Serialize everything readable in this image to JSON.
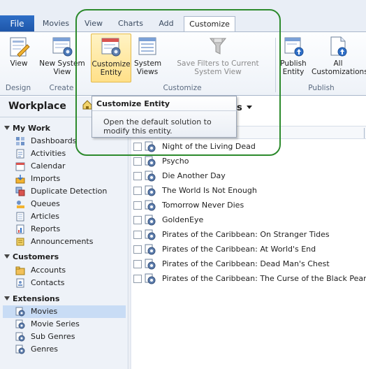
{
  "tabs": [
    {
      "label": "File",
      "active": false
    },
    {
      "label": "Movies",
      "active": false
    },
    {
      "label": "View",
      "active": false
    },
    {
      "label": "Charts",
      "active": false
    },
    {
      "label": "Add",
      "active": false
    },
    {
      "label": "Customize",
      "active": true
    }
  ],
  "ribbon": {
    "buttons": [
      {
        "label": "View",
        "icon": "pencil-form-icon"
      },
      {
        "label": "New System View",
        "icon": "new-view-icon"
      },
      {
        "label": "Customize Entity",
        "icon": "customize-entity-icon"
      },
      {
        "label": "System Views",
        "icon": "system-views-icon"
      },
      {
        "label": "Save Filters to Current System View",
        "icon": "filter-icon"
      },
      {
        "label": "Publish Entity",
        "icon": "publish-entity-icon"
      },
      {
        "label": "All Customizations",
        "icon": "publish-all-icon"
      }
    ],
    "groups": [
      "Design",
      "Create",
      "Customize",
      "Publish"
    ]
  },
  "tooltip": {
    "title": "Customize Entity",
    "body": "Open the default solution to modify this entity."
  },
  "nav": {
    "title": "Workplace",
    "sections": [
      {
        "label": "My Work",
        "items": [
          "Dashboards",
          "Activities",
          "Calendar",
          "Imports",
          "Duplicate Detection",
          "Queues",
          "Articles",
          "Reports",
          "Announcements"
        ]
      },
      {
        "label": "Customers",
        "items": [
          "Accounts",
          "Contacts"
        ]
      },
      {
        "label": "Extensions",
        "items": [
          "Movies",
          "Movie Series",
          "Sub Genres",
          "Genres"
        ]
      }
    ],
    "selected": "Movies"
  },
  "grid": {
    "view_suffix": "s",
    "rows": [
      "Night of the Living Dead",
      "Psycho",
      "Die Another Day",
      "The World Is Not Enough",
      "Tomorrow Never Dies",
      "GoldenEye",
      "Pirates of the Caribbean: On Stranger Tides",
      "Pirates of the Caribbean: At World's End",
      "Pirates of the Caribbean: Dead Man's Chest",
      "Pirates of the Caribbean: The Curse of the Black Pearl"
    ]
  },
  "colors": {
    "accent": "#1d55a8",
    "highlight": "#ffe089",
    "annotation": "#2c8a2c",
    "nav_selected": "#c8dcf5"
  }
}
